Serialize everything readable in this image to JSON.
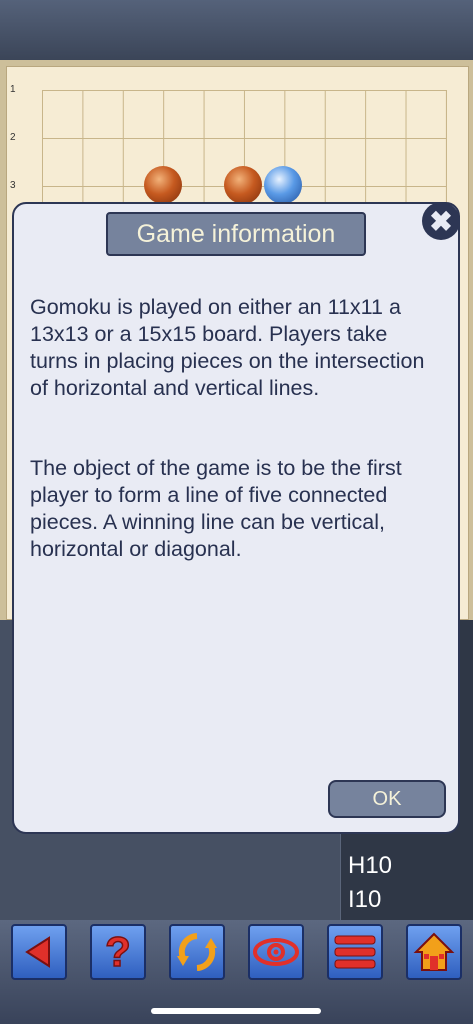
{
  "board": {
    "row_labels": [
      "1",
      "2",
      "3"
    ]
  },
  "moves": [
    "H10",
    "I10"
  ],
  "toolbar": {
    "buttons": [
      {
        "icon": "back-arrow-icon"
      },
      {
        "icon": "help-icon"
      },
      {
        "icon": "swap-icon"
      },
      {
        "icon": "eye-icon"
      },
      {
        "icon": "menu-icon"
      },
      {
        "icon": "home-icon"
      }
    ]
  },
  "dialog": {
    "title": "Game information",
    "paragraph1": "Gomoku is played on either an 11x11 a 13x13 or a 15x15 board. Players take turns in placing pieces on the intersection of horizontal and vertical lines.",
    "paragraph2": "The object of the game is to be the first player to form a line of five connected pieces. A winning line can be vertical, horizontal or diagonal.",
    "ok_label": "OK",
    "close_icon": "close-icon"
  },
  "colors": {
    "accent": "#76839d",
    "dialog_bg": "#e9ebf4",
    "text": "#283150"
  }
}
